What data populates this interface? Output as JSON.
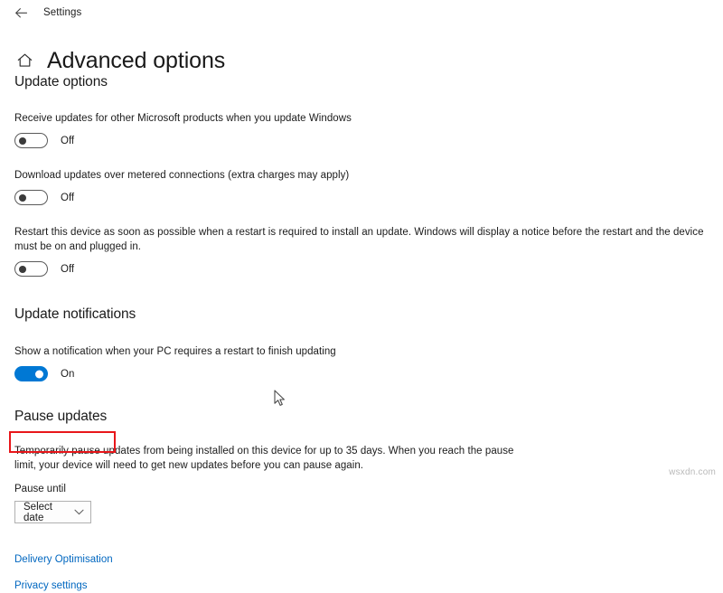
{
  "titlebar": {
    "back_icon": "back-arrow-icon",
    "label": "Settings"
  },
  "header": {
    "home_icon": "home-icon",
    "title": "Advanced options"
  },
  "sections": {
    "update_options": {
      "heading": "Update options",
      "settings": [
        {
          "description": "Receive updates for other Microsoft products when you update Windows",
          "state": "Off",
          "on": false
        },
        {
          "description": "Download updates over metered connections (extra charges may apply)",
          "state": "Off",
          "on": false
        },
        {
          "description": "Restart this device as soon as possible when a restart is required to install an update. Windows will display a notice before the restart and the device must be on and plugged in.",
          "state": "Off",
          "on": false
        }
      ]
    },
    "update_notifications": {
      "heading": "Update notifications",
      "settings": [
        {
          "description": "Show a notification when your PC requires a restart to finish updating",
          "state": "On",
          "on": true
        }
      ]
    },
    "pause_updates": {
      "heading": "Pause updates",
      "description": "Temporarily pause updates from being installed on this device for up to 35 days. When you reach the pause limit, your device will need to get new updates before you can pause again.",
      "field_label": "Pause until",
      "dropdown_value": "Select date",
      "dropdown_icon": "chevron-down-icon"
    }
  },
  "links": [
    {
      "label": "Delivery Optimisation",
      "highlighted": true
    },
    {
      "label": "Privacy settings",
      "highlighted": false
    }
  ],
  "colors": {
    "accent": "#0078d4",
    "link": "#0067c0",
    "annotation": "#e8161a"
  },
  "watermark": "wsxdn.com"
}
